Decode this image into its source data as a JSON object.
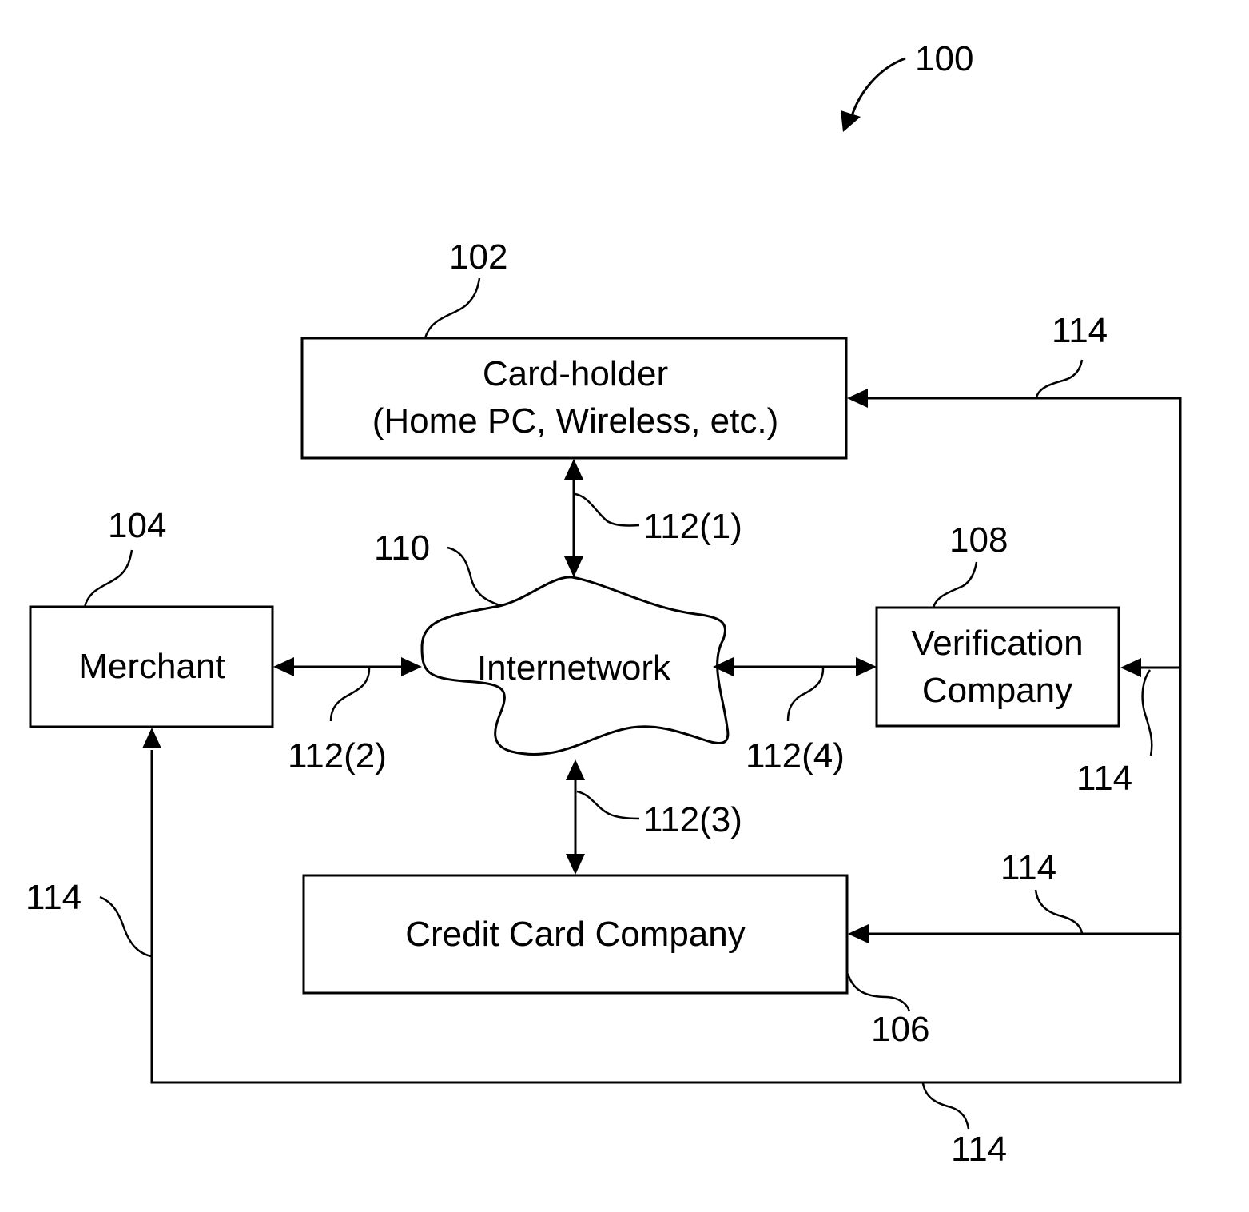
{
  "figure": {
    "ref": "100"
  },
  "nodes": {
    "cardholder": {
      "ref": "102",
      "line1": "Card-holder",
      "line2": "(Home PC, Wireless, etc.)"
    },
    "merchant": {
      "ref": "104",
      "label": "Merchant"
    },
    "credit_card_company": {
      "ref": "106",
      "label": "Credit Card Company"
    },
    "verification_company": {
      "ref": "108",
      "line1": "Verification",
      "line2": "Company"
    },
    "internetwork": {
      "ref": "110",
      "label": "Internetwork"
    }
  },
  "links": {
    "l1": "112(1)",
    "l2": "112(2)",
    "l3": "112(3)",
    "l4": "112(4)",
    "bus_top": "114",
    "bus_verification": "114",
    "bus_credit": "114",
    "bus_merchant": "114",
    "bus_bottom": "114"
  }
}
